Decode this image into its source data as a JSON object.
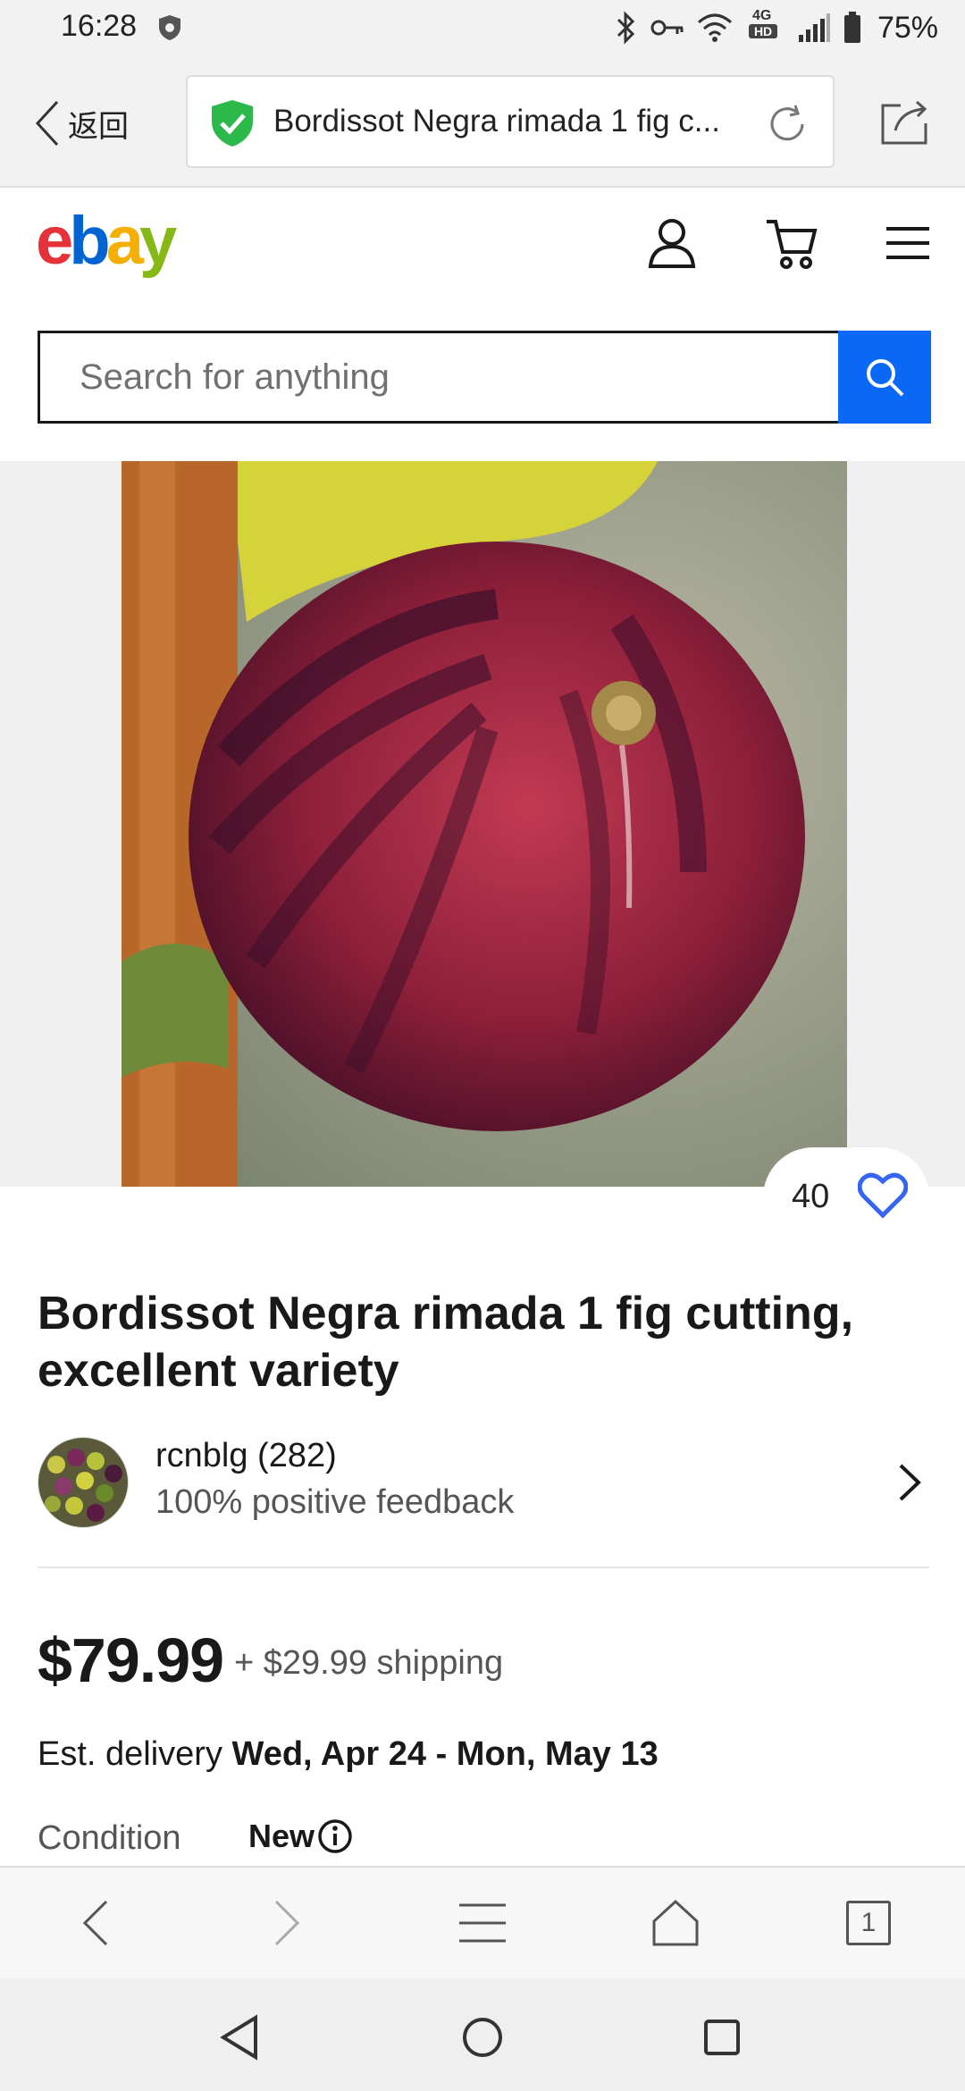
{
  "status_bar": {
    "time": "16:28",
    "network": "4G",
    "network_sub": "HD",
    "battery": "75%"
  },
  "browser": {
    "back_label": "返回",
    "url_title": "Bordissot Negra rimada 1 fig c..."
  },
  "header": {
    "logo": {
      "e": "e",
      "b": "b",
      "a": "a",
      "y": "y"
    },
    "search_placeholder": "Search for anything"
  },
  "listing": {
    "watch_count": "40",
    "title": "Bordissot Negra rimada 1 fig cutting, excellent variety",
    "seller": {
      "name": "rcnblg (282)",
      "feedback": "100% positive feedback"
    },
    "price": "$79.99",
    "shipping": "+ $29.99 shipping",
    "delivery_label": "Est. delivery",
    "delivery_dates": "Wed, Apr 24 - Mon, May 13",
    "condition_label": "Condition",
    "condition_value": "New"
  },
  "bottom_toolbar": {
    "tab_count": "1"
  },
  "colors": {
    "ebay_red": "#e53238",
    "ebay_blue": "#0064d2",
    "ebay_yellow": "#f5af02",
    "ebay_green": "#86b817",
    "search_button": "#0968f6",
    "secure_green": "#2db84c"
  }
}
